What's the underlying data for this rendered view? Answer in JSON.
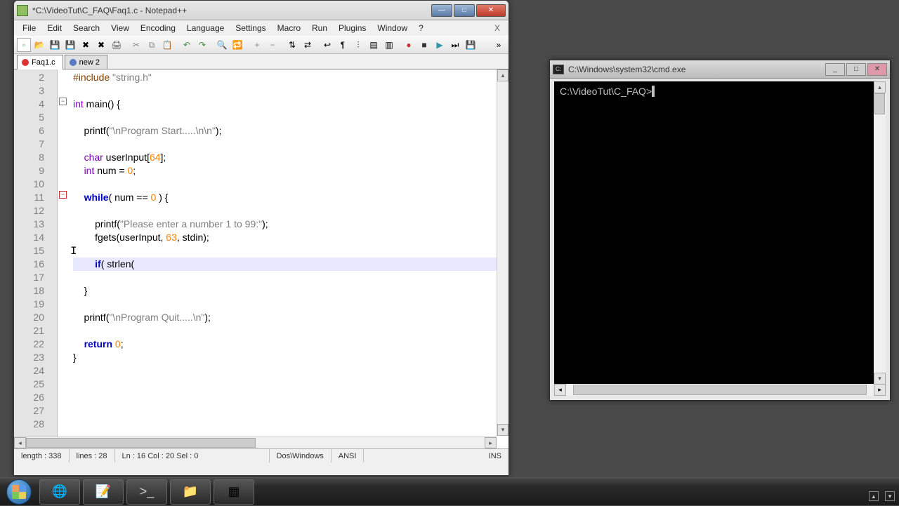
{
  "npp": {
    "title": "*C:\\VideoTut\\C_FAQ\\Faq1.c - Notepad++",
    "menu": [
      "File",
      "Edit",
      "Search",
      "View",
      "Encoding",
      "Language",
      "Settings",
      "Macro",
      "Run",
      "Plugins",
      "Window",
      "?"
    ],
    "tabs": [
      {
        "label": "Faq1.c",
        "active": true,
        "dirty": true
      },
      {
        "label": "new  2",
        "active": false,
        "dirty": false
      }
    ],
    "line_start": 2,
    "line_count": 27,
    "highlight_line": 16,
    "code_html": [
      "<span class='pre'>#include</span> <span class='str'>\"string.h\"</span>",
      "",
      "<span class='ty'>int</span> main<span>()</span> <span>{</span>",
      "",
      "    printf<span>(</span><span class='str'>\"\\nProgram Start.....\\n\\n\"</span><span>)</span>;",
      "",
      "    <span class='ty'>char</span> userInput<span>[</span><span class='num'>64</span><span>]</span>;",
      "    <span class='ty'>int</span> num = <span class='num'>0</span>;",
      "",
      "    <span class='kw'>while</span><span>(</span> num == <span class='num'>0</span> <span>)</span> <span>{</span>",
      "",
      "        printf<span>(</span><span class='str'>\"Please enter a number 1 to 99:\"</span><span>)</span>;",
      "        fgets<span>(</span>userInput, <span class='num'>63</span>, stdin<span>)</span>;",
      "",
      "        <span class='kw'>if</span><span>(</span> strlen<span>(</span>",
      "",
      "    <span>}</span>",
      "",
      "    printf<span>(</span><span class='str'>\"\\nProgram Quit.....\\n\"</span><span>)</span>;",
      "",
      "    <span class='kw'>return</span> <span class='num'>0</span>;",
      "<span>}</span>",
      "",
      "",
      "",
      "",
      ""
    ],
    "status": {
      "length": "length : 338",
      "lines": "lines : 28",
      "pos": "Ln : 16    Col : 20    Sel : 0",
      "eol": "Dos\\Windows",
      "enc": "ANSI",
      "mode": "INS"
    }
  },
  "cmd": {
    "title": "C:\\Windows\\system32\\cmd.exe",
    "prompt": "C:\\VideoTut\\C_FAQ>"
  },
  "taskbar": {
    "items": [
      "chrome",
      "notepadpp",
      "cmd",
      "explorer",
      "app"
    ]
  }
}
